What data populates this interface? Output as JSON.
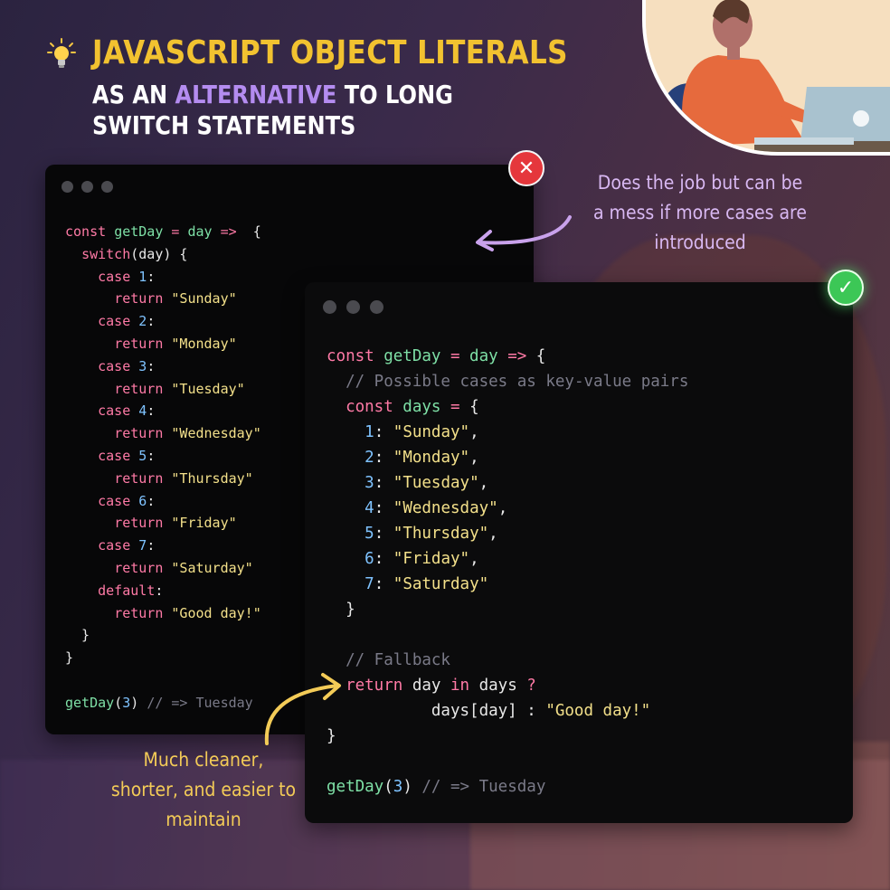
{
  "title": {
    "main": "JAVASCRIPT OBJECT LITERALS",
    "line1_before": "AS AN ",
    "line1_highlight": "ALTERNATIVE",
    "line1_after": " TO LONG",
    "line2": "SWITCH STATEMENTS"
  },
  "notes": {
    "bad": [
      "Does the job but can be",
      "a mess if more cases are",
      "introduced"
    ],
    "good": [
      "Much cleaner,",
      "shorter, and easier to",
      "maintain"
    ]
  },
  "icons": {
    "bulb": "lightbulb-icon",
    "bad_badge": "x-mark-icon",
    "good_badge": "check-mark-icon"
  },
  "colors": {
    "title": "#f2c230",
    "highlight": "#b48cf0",
    "keyword": "#ff7aa6",
    "function": "#7ee0a6",
    "string": "#f3e08a",
    "number": "#7fc3ff",
    "comment": "#7a7a88",
    "bad": "#e5373c",
    "good": "#3cc756"
  },
  "switch_code": [
    [
      [
        "kw",
        "const "
      ],
      [
        "fn",
        "getDay"
      ],
      [
        "op",
        " = "
      ],
      [
        "fn",
        "day"
      ],
      [
        "op",
        " =>"
      ],
      [
        "",
        "  {"
      ]
    ],
    [
      [
        "",
        "  "
      ],
      [
        "kw",
        "switch"
      ],
      [
        "",
        "(day) {"
      ]
    ],
    [
      [
        "",
        "    "
      ],
      [
        "kw",
        "case "
      ],
      [
        "num",
        "1"
      ],
      [
        "",
        ":"
      ]
    ],
    [
      [
        "",
        "      "
      ],
      [
        "kw",
        "return "
      ],
      [
        "str",
        "\"Sunday\""
      ]
    ],
    [
      [
        "",
        "    "
      ],
      [
        "kw",
        "case "
      ],
      [
        "num",
        "2"
      ],
      [
        "",
        ":"
      ]
    ],
    [
      [
        "",
        "      "
      ],
      [
        "kw",
        "return "
      ],
      [
        "str",
        "\"Monday\""
      ]
    ],
    [
      [
        "",
        "    "
      ],
      [
        "kw",
        "case "
      ],
      [
        "num",
        "3"
      ],
      [
        "",
        ":"
      ]
    ],
    [
      [
        "",
        "      "
      ],
      [
        "kw",
        "return "
      ],
      [
        "str",
        "\"Tuesday\""
      ]
    ],
    [
      [
        "",
        "    "
      ],
      [
        "kw",
        "case "
      ],
      [
        "num",
        "4"
      ],
      [
        "",
        ":"
      ]
    ],
    [
      [
        "",
        "      "
      ],
      [
        "kw",
        "return "
      ],
      [
        "str",
        "\"Wednesday\""
      ]
    ],
    [
      [
        "",
        "    "
      ],
      [
        "kw",
        "case "
      ],
      [
        "num",
        "5"
      ],
      [
        "",
        ":"
      ]
    ],
    [
      [
        "",
        "      "
      ],
      [
        "kw",
        "return "
      ],
      [
        "str",
        "\"Thursday\""
      ]
    ],
    [
      [
        "",
        "    "
      ],
      [
        "kw",
        "case "
      ],
      [
        "num",
        "6"
      ],
      [
        "",
        ":"
      ]
    ],
    [
      [
        "",
        "      "
      ],
      [
        "kw",
        "return "
      ],
      [
        "str",
        "\"Friday\""
      ]
    ],
    [
      [
        "",
        "    "
      ],
      [
        "kw",
        "case "
      ],
      [
        "num",
        "7"
      ],
      [
        "",
        ":"
      ]
    ],
    [
      [
        "",
        "      "
      ],
      [
        "kw",
        "return "
      ],
      [
        "str",
        "\"Saturday\""
      ]
    ],
    [
      [
        "",
        "    "
      ],
      [
        "kw",
        "default"
      ],
      [
        "",
        ":"
      ]
    ],
    [
      [
        "",
        "      "
      ],
      [
        "kw",
        "return "
      ],
      [
        "str",
        "\"Good day!\""
      ]
    ],
    [
      [
        "",
        "  }"
      ]
    ],
    [
      [
        "",
        "}"
      ]
    ],
    [
      [
        "",
        ""
      ]
    ],
    [
      [
        "fn",
        "getDay"
      ],
      [
        "",
        "("
      ],
      [
        "num",
        "3"
      ],
      [
        "",
        ") "
      ],
      [
        "cm",
        "// => Tuesday"
      ]
    ]
  ],
  "object_code": [
    [
      [
        "kw",
        "const "
      ],
      [
        "fn",
        "getDay"
      ],
      [
        "op",
        " = "
      ],
      [
        "fn",
        "day"
      ],
      [
        "op",
        " =>"
      ],
      [
        "",
        " {"
      ]
    ],
    [
      [
        "",
        "  "
      ],
      [
        "cm",
        "// Possible cases as key-value pairs"
      ]
    ],
    [
      [
        "",
        "  "
      ],
      [
        "kw",
        "const "
      ],
      [
        "fn",
        "days"
      ],
      [
        "op",
        " ="
      ],
      [
        "",
        " {"
      ]
    ],
    [
      [
        "",
        "    "
      ],
      [
        "num",
        "1"
      ],
      [
        "",
        ": "
      ],
      [
        "str",
        "\"Sunday\""
      ],
      [
        "",
        ","
      ]
    ],
    [
      [
        "",
        "    "
      ],
      [
        "num",
        "2"
      ],
      [
        "",
        ": "
      ],
      [
        "str",
        "\"Monday\""
      ],
      [
        "",
        ","
      ]
    ],
    [
      [
        "",
        "    "
      ],
      [
        "num",
        "3"
      ],
      [
        "",
        ": "
      ],
      [
        "str",
        "\"Tuesday\""
      ],
      [
        "",
        ","
      ]
    ],
    [
      [
        "",
        "    "
      ],
      [
        "num",
        "4"
      ],
      [
        "",
        ": "
      ],
      [
        "str",
        "\"Wednesday\""
      ],
      [
        "",
        ","
      ]
    ],
    [
      [
        "",
        "    "
      ],
      [
        "num",
        "5"
      ],
      [
        "",
        ": "
      ],
      [
        "str",
        "\"Thursday\""
      ],
      [
        "",
        ","
      ]
    ],
    [
      [
        "",
        "    "
      ],
      [
        "num",
        "6"
      ],
      [
        "",
        ": "
      ],
      [
        "str",
        "\"Friday\""
      ],
      [
        "",
        ","
      ]
    ],
    [
      [
        "",
        "    "
      ],
      [
        "num",
        "7"
      ],
      [
        "",
        ": "
      ],
      [
        "str",
        "\"Saturday\""
      ]
    ],
    [
      [
        "",
        "  }"
      ]
    ],
    [
      [
        "",
        ""
      ]
    ],
    [
      [
        "",
        "  "
      ],
      [
        "cm",
        "// Fallback"
      ]
    ],
    [
      [
        "",
        "  "
      ],
      [
        "kw",
        "return "
      ],
      [
        "",
        "day "
      ],
      [
        "kw",
        "in "
      ],
      [
        "",
        "days "
      ],
      [
        "op",
        "?"
      ]
    ],
    [
      [
        "",
        "           days[day] : "
      ],
      [
        "str",
        "\"Good day!\""
      ]
    ],
    [
      [
        "",
        "}"
      ]
    ],
    [
      [
        "",
        ""
      ]
    ],
    [
      [
        "fn",
        "getDay"
      ],
      [
        "",
        "("
      ],
      [
        "num",
        "3"
      ],
      [
        "",
        ") "
      ],
      [
        "cm",
        "// => Tuesday"
      ]
    ]
  ]
}
